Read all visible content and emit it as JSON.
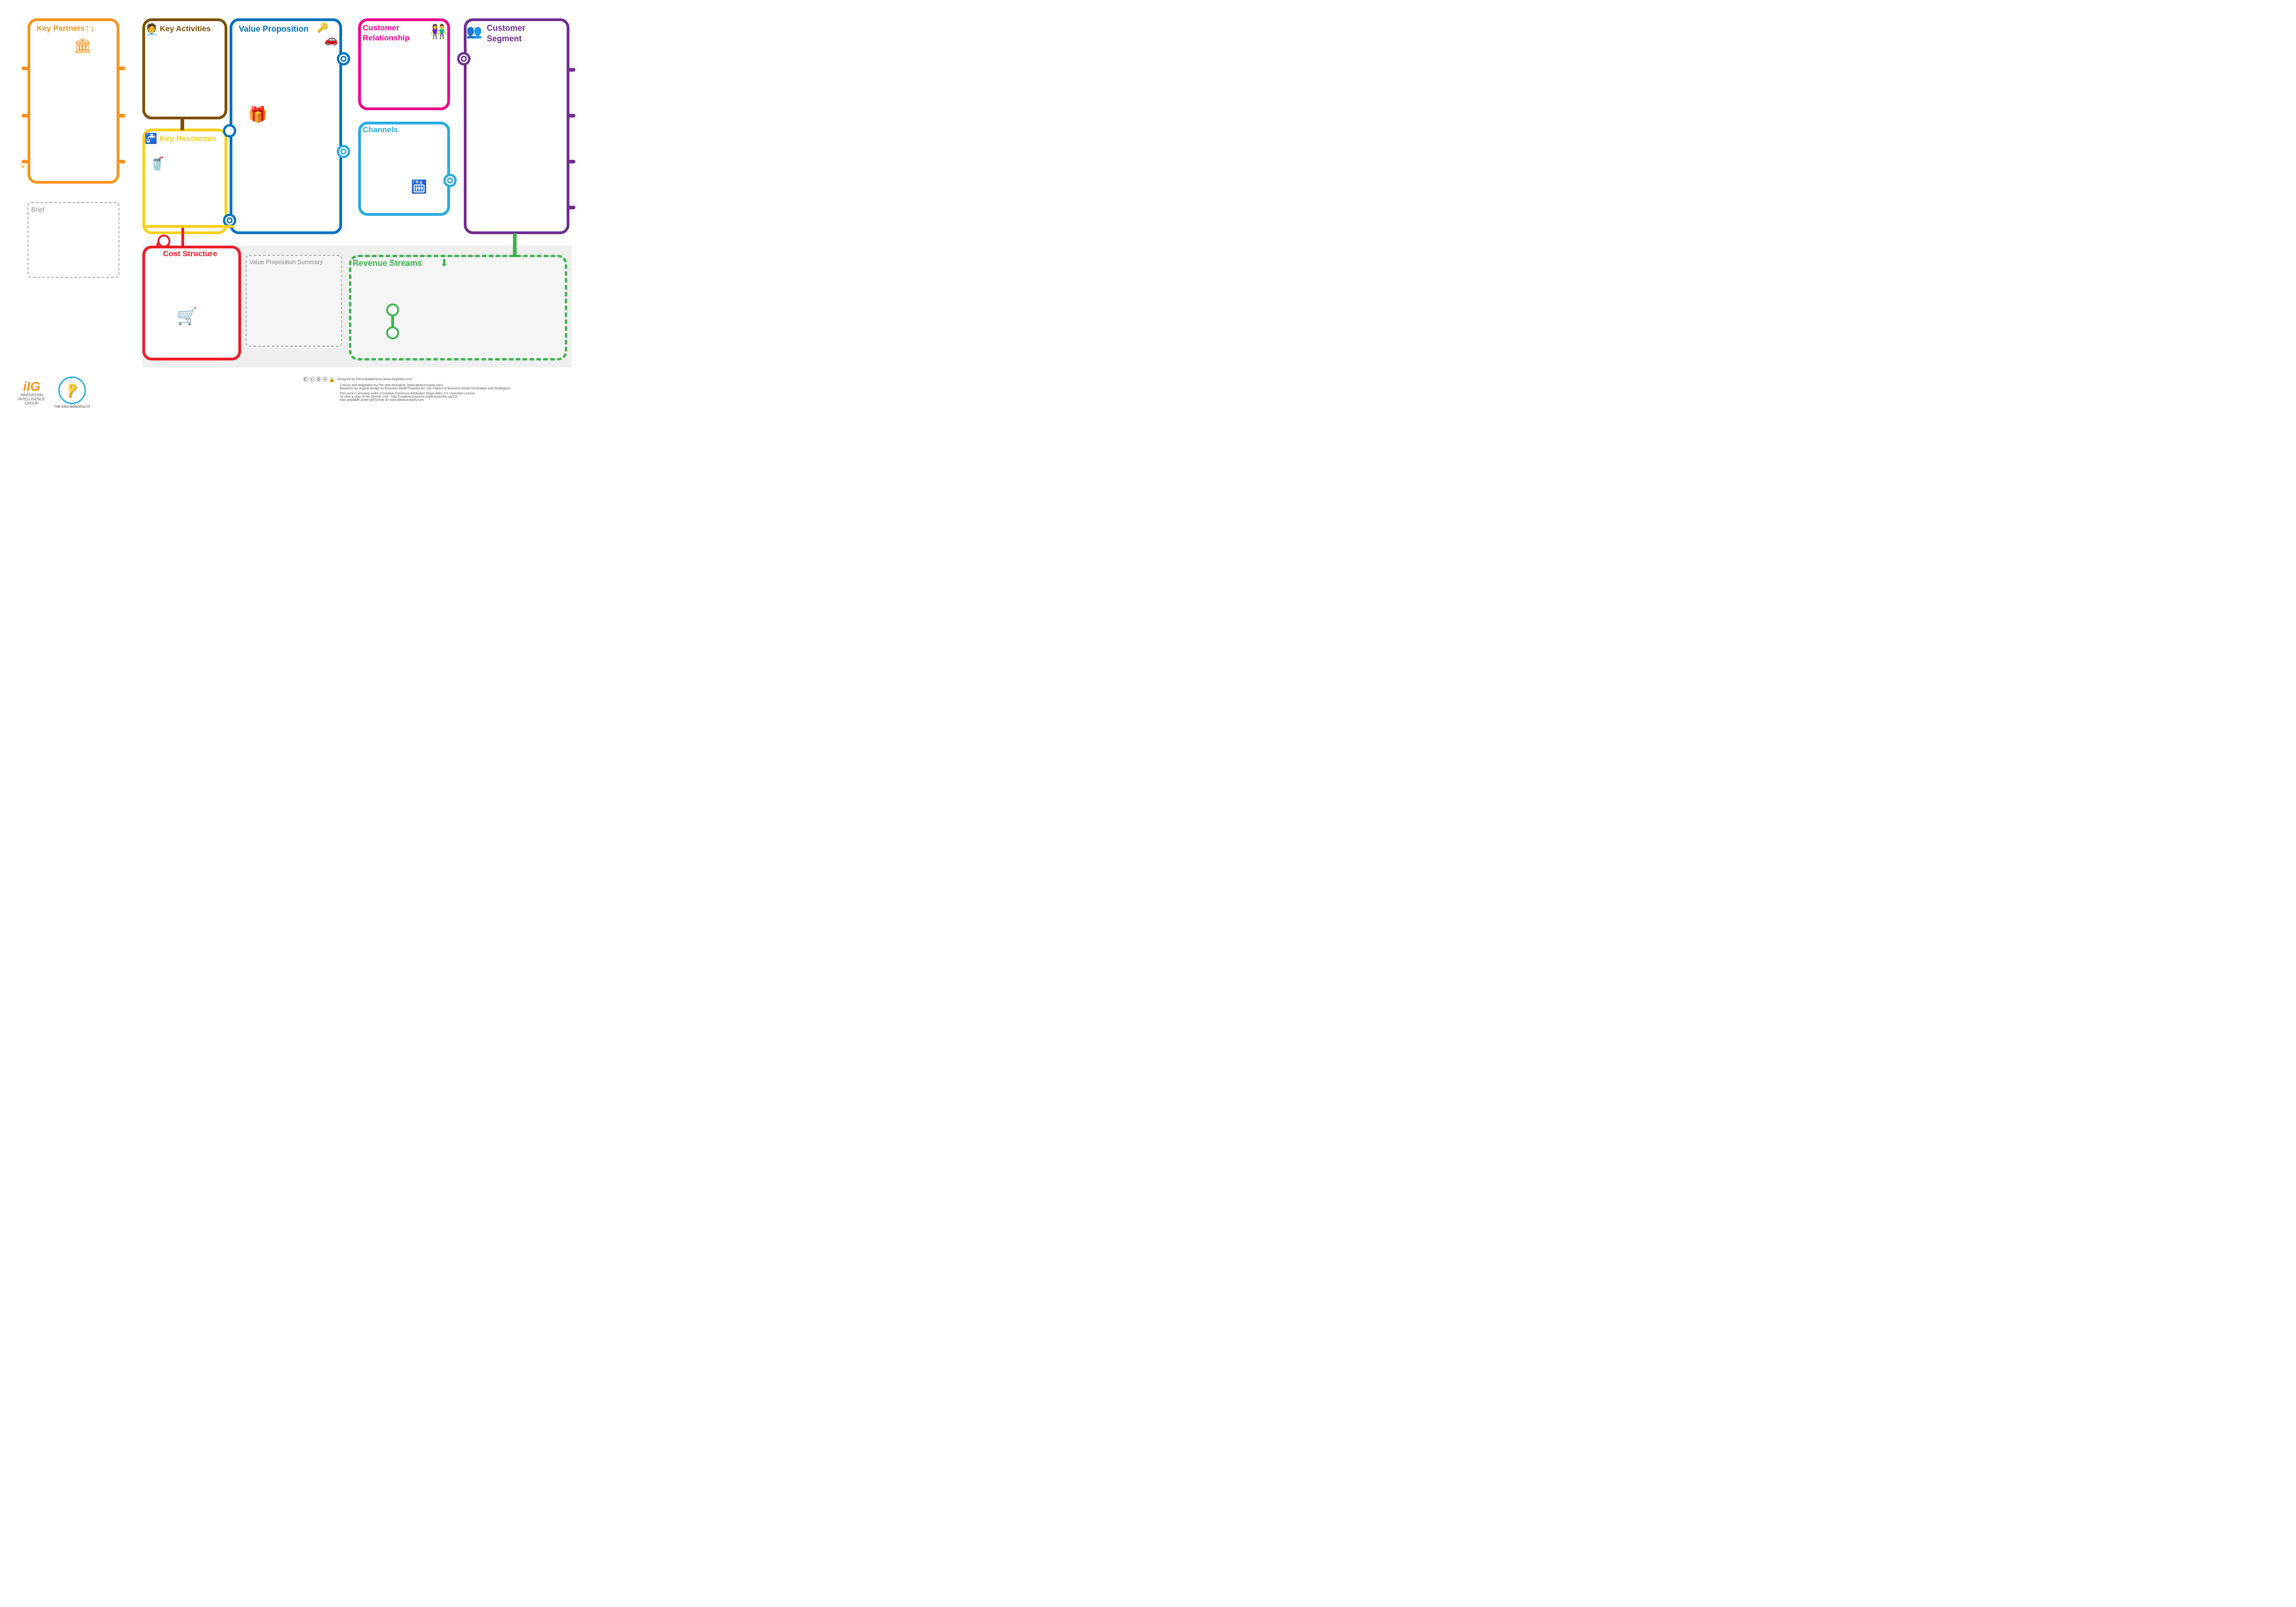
{
  "sections": {
    "key_partners": {
      "title": "Key Partners",
      "color": "#F7941D"
    },
    "key_activities": {
      "title": "Key Activities",
      "color": "#7B4F00"
    },
    "key_resources": {
      "title": "Key Resources",
      "color": "#F7D01A"
    },
    "value_proposition": {
      "title": "Value Proposition",
      "color": "#0072BC"
    },
    "customer_relationship": {
      "title": "Customer Relationship",
      "color": "#EC008C"
    },
    "channels": {
      "title": "Channels",
      "color": "#29ABE2"
    },
    "customer_segment": {
      "title": "Customer Segment",
      "color": "#6F2C91"
    },
    "cost_structure": {
      "title": "Cost Structure",
      "color": "#ED1C24"
    },
    "revenue_streams": {
      "title": "Revenue Streams",
      "color": "#39B54A"
    },
    "value_proposition_summary": {
      "title": "Value Proposition Summary",
      "color": "#888888"
    },
    "brief": {
      "title": "Brief",
      "color": "#888888"
    }
  },
  "footer": {
    "iig": {
      "letters": "iIG",
      "line1": "INNOVATION",
      "line2": "INTELLIGENCE",
      "line3": "GROUP"
    },
    "idea_monopoly": {
      "label": "THE IDEA MONOPOLY®"
    },
    "credits_line1": "Designed by Elena Balakhnova (www.IIGglobal.com)",
    "credits_line2": "Colours and adaptation by The Idea Monopoly (www.ideamonopoly.com)",
    "credits_line3": "Based on an original design by Business Model Foundry AG, the makers of Business Model Generation and Strategyzer",
    "license_line1": "This work is licensed under a Creative Commons Attribution Share-Alike 3.0. Unported License",
    "license_line2": "To view a copy of this license, visit : http://creativecommons.org/licenses/by-sa/3.0/",
    "license_line3": "Also available under pdf format at: www.ideamonopoly.com"
  }
}
